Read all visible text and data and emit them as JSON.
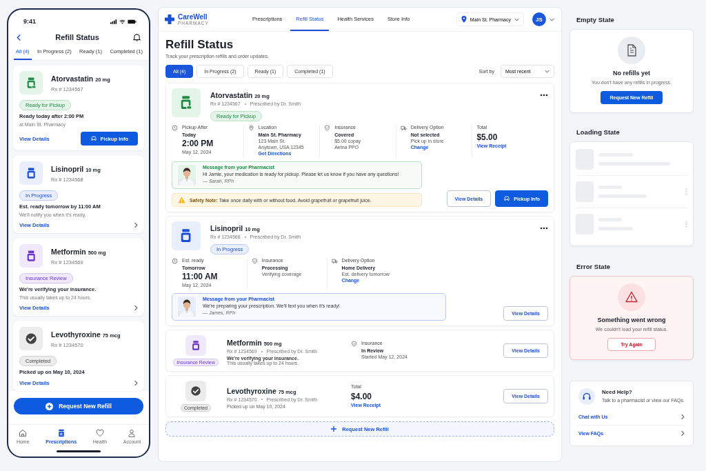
{
  "phone": {
    "time": "9:41",
    "title": "Refill Status",
    "tabs": [
      {
        "label": "All (4)",
        "selected": true
      },
      {
        "label": "In Progress (2)",
        "selected": false
      },
      {
        "label": "Ready (1)",
        "selected": false
      },
      {
        "label": "Completed (1)",
        "selected": false
      }
    ],
    "cards": [
      {
        "kind": "ready",
        "name": "Atorvastatin",
        "dose": "20 mg",
        "rx": "Rx # 1234567",
        "status": "Ready for Pickup",
        "line1": "Ready today after 2:00 PM",
        "line2": "at Main St. Pharmacy",
        "link": "View Details",
        "button": "Pickup Info"
      },
      {
        "kind": "progress",
        "name": "Lisinopril",
        "dose": "10 mg",
        "rx": "Rx # 1234568",
        "status": "In Progress",
        "line1": "Est. ready tomorrow by 11:00 AM",
        "line2": "We'll notify you when it's ready.",
        "link": "View Details"
      },
      {
        "kind": "review",
        "name": "Metformin",
        "dose": "500 mg",
        "rx": "Rx # 1234569",
        "status": "Insurance Review",
        "line1": "We're verifying your insurance.",
        "line2": "This usually takes up to 24 hours.",
        "link": "View Details"
      },
      {
        "kind": "completed",
        "name": "Levothyroxine",
        "dose": "75 mcg",
        "rx": "Rx # 1234570",
        "status": "Completed",
        "line1": "Picked up on May 10, 2024",
        "link": "View Details"
      }
    ],
    "request_button": "Request New Refill",
    "nav": [
      {
        "kind": "home",
        "label": "Home",
        "selected": false
      },
      {
        "kind": "rx",
        "label": "Prescriptions",
        "selected": true
      },
      {
        "kind": "heart",
        "label": "Health",
        "selected": false
      },
      {
        "kind": "person",
        "label": "Account",
        "selected": false
      }
    ]
  },
  "web": {
    "brand": {
      "name": "CareWell",
      "sub": "PHARMACY"
    },
    "nav": [
      {
        "label": "Prescriptions",
        "selected": false
      },
      {
        "label": "Refill Status",
        "selected": true
      },
      {
        "label": "Health Services",
        "selected": false
      },
      {
        "label": "Store Info",
        "selected": false
      }
    ],
    "store": "Main St. Pharmacy",
    "avatar": "JS",
    "title": "Refill Status",
    "subtitle": "Track your prescription refills and order updates.",
    "filters": [
      {
        "label": "All (4)",
        "selected": true
      },
      {
        "label": "In Progress (2)",
        "selected": false
      },
      {
        "label": "Ready (1)",
        "selected": false
      },
      {
        "label": "Completed (1)",
        "selected": false
      }
    ],
    "sort_label": "Sort by",
    "sort_value": "Most recent",
    "refills": [
      {
        "kind": "ready",
        "name": "Atorvastatin",
        "dose": "20 mg",
        "rx": "Rx # 1234567",
        "prescriber": "Prescribed by Dr. Smith",
        "status": "Ready for Pickup",
        "facts": [
          {
            "kind": "clock",
            "label": "Pickup After",
            "lines": [
              {
                "kind": "bold",
                "text": "Today"
              },
              {
                "kind": "time",
                "text": "2:00 PM"
              },
              {
                "kind": "text",
                "text": "May 12, 2024"
              }
            ]
          },
          {
            "kind": "pin",
            "label": "Location",
            "lines": [
              {
                "kind": "bold",
                "text": "Main St. Pharmacy"
              },
              {
                "kind": "text",
                "text": "123 Main St."
              },
              {
                "kind": "text",
                "text": "Anytown, USA 12345"
              },
              {
                "kind": "link",
                "text": "Get Directions"
              }
            ]
          },
          {
            "kind": "shield",
            "label": "Insurance",
            "lines": [
              {
                "kind": "bold",
                "text": "Covered"
              },
              {
                "kind": "text",
                "text": "$5.00 copay"
              },
              {
                "kind": "text",
                "text": "Aetna PPO"
              }
            ]
          },
          {
            "kind": "truck",
            "label": "Delivery Option",
            "lines": [
              {
                "kind": "bold",
                "text": "Not selected"
              },
              {
                "kind": "text",
                "text": "Pick up in store"
              },
              {
                "kind": "link",
                "text": "Change"
              }
            ]
          },
          {
            "kind": "plain",
            "label": "Total",
            "lines": [
              {
                "kind": "price",
                "text": "$5.00"
              },
              {
                "kind": "link",
                "text": "View Receipt"
              }
            ]
          }
        ],
        "message": {
          "kind": "ready",
          "title": "Message from your Pharmacist",
          "text": "Hi Jamie, your medication is ready for pickup. Please let us know if you have any questions!",
          "sign": "— Sarah, RPh"
        },
        "safety": "**Safety Note:** Take once daily with or without food. Avoid grapefruit or grapefruit juice.",
        "buttons": [
          {
            "kind": "outline",
            "label": "View Details"
          },
          {
            "kind": "primary",
            "label": "Pickup Info"
          }
        ]
      },
      {
        "kind": "progress",
        "name": "Lisinopril",
        "dose": "10 mg",
        "rx": "Rx # 1234568",
        "prescriber": "Prescribed by Dr. Smith",
        "status": "In Progress",
        "facts": [
          {
            "kind": "clock",
            "label": "Est. ready",
            "lines": [
              {
                "kind": "bold",
                "text": "Tomorrow"
              },
              {
                "kind": "time",
                "text": "11:00 AM"
              },
              {
                "kind": "text",
                "text": "May 12, 2024"
              }
            ]
          },
          {
            "kind": "shield",
            "label": "Insurance",
            "lines": [
              {
                "kind": "bold",
                "text": "Processing"
              },
              {
                "kind": "text",
                "text": "Verifying coverage"
              }
            ]
          },
          {
            "kind": "truck",
            "label": "Delivery Option",
            "lines": [
              {
                "kind": "bold",
                "text": "Home Delivery"
              },
              {
                "kind": "text",
                "text": "Est. delivery tomorrow"
              },
              {
                "kind": "link",
                "text": "Change"
              }
            ]
          }
        ],
        "message": {
          "kind": "progress",
          "title": "Message from your Pharmacist",
          "text": "We're preparing your prescription. We'll text you when it's ready!",
          "sign": "— James, RPh"
        },
        "buttons": [
          {
            "kind": "outline",
            "label": "View Details"
          }
        ]
      },
      {
        "kind": "review",
        "name": "Metformin",
        "dose": "500 mg",
        "rx": "Rx # 1234569",
        "prescriber": "Prescribed by Dr. Smith",
        "status": "Insurance Review",
        "notes": [
          {
            "kind": "bold",
            "text": "We're verifying your insurance."
          },
          {
            "kind": "text",
            "text": "This usually takes up to 24 hours."
          }
        ],
        "facts": [
          {
            "kind": "shield",
            "label": "Insurance",
            "lines": [
              {
                "kind": "bold",
                "text": "In Review"
              },
              {
                "kind": "text",
                "text": "Started May 12, 2024"
              }
            ]
          }
        ],
        "buttons": [
          {
            "kind": "outline",
            "label": "View Details"
          }
        ]
      },
      {
        "kind": "completed",
        "name": "Levothyroxine",
        "dose": "75 mcg",
        "rx": "Rx # 1234570",
        "prescriber": "Prescribed by Dr. Smith",
        "status": "Completed",
        "notes": [
          {
            "kind": "text",
            "text": "Picked up on May 10, 2024"
          }
        ],
        "facts": [
          {
            "kind": "plain",
            "label": "Total",
            "lines": [
              {
                "kind": "price",
                "text": "$4.00"
              },
              {
                "kind": "link",
                "text": "View Receipt"
              }
            ]
          }
        ],
        "buttons": [
          {
            "kind": "outline",
            "label": "View Details"
          }
        ]
      }
    ],
    "request_button": "Request New Refill"
  },
  "states": {
    "empty": {
      "heading": "Empty State",
      "title": "No refills yet",
      "text": "You don't have any refills in progress.",
      "button": "Request New Refill"
    },
    "loading": {
      "heading": "Loading State"
    },
    "error": {
      "heading": "Error State",
      "title": "Something went wrong",
      "text": "We couldn't load your refill status.",
      "button": "Try Again"
    },
    "help": {
      "title": "Need Help?",
      "text": "Talk to a pharmacist or view our FAQs.",
      "links": [
        "Chat with Us",
        "View FAQs"
      ]
    }
  }
}
